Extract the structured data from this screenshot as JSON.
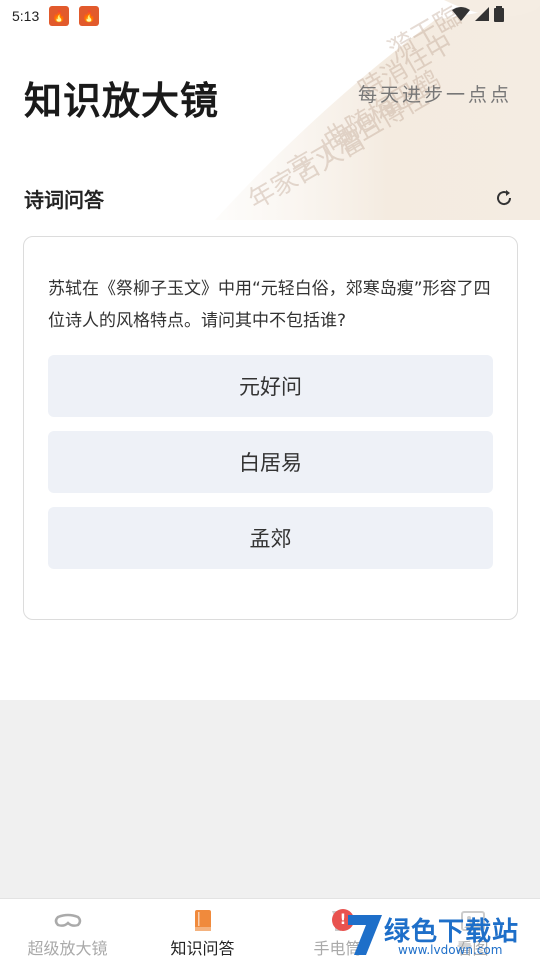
{
  "status_bar": {
    "time": "5:13",
    "notification_icons": [
      "app-notification-icon",
      "app-notification-icon"
    ]
  },
  "header": {
    "title": "知识放大镜",
    "subtitle": "每天进步一点点"
  },
  "section": {
    "title": "诗词问答"
  },
  "quiz": {
    "question": "苏轼在《祭柳子玉文》中用“元轻白俗，郊寒岛瘦”形容了四位诗人的风格特点。请问其中不包括谁?",
    "options": [
      "元好问",
      "白居易",
      "孟郊"
    ]
  },
  "tabs": [
    {
      "label": "超级放大镜",
      "icon": "glasses-icon",
      "active": false
    },
    {
      "label": "知识问答",
      "icon": "book-icon",
      "active": true
    },
    {
      "label": "手电筒",
      "icon": "flashlight-icon",
      "active": false
    },
    {
      "label": "看图",
      "icon": "image-icon",
      "active": false
    }
  ],
  "watermark": {
    "text": "绿色下载站",
    "url": "www.lvdown.com"
  },
  "colors": {
    "accent": "#f08a3c",
    "option_bg": "#eef1f7",
    "badge": "#e8524f"
  }
}
